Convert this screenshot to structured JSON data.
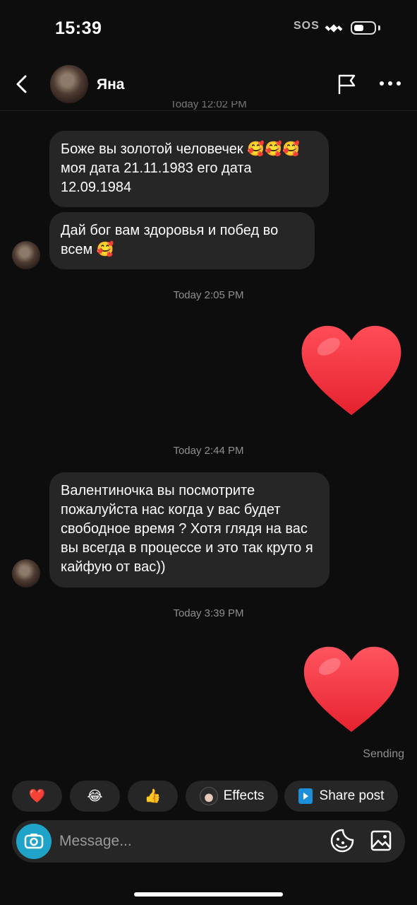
{
  "status_bar": {
    "time": "15:39",
    "sos": "SOS"
  },
  "header": {
    "contact_name": "Яна"
  },
  "partial_timestamp": "Today 12:02 PM",
  "messages": [
    {
      "text": "Боже вы золотой человечек 🥰🥰🥰 моя дата 21.11.1983 его дата 12.09.1984"
    },
    {
      "text": "Дай бог вам здоровья и побед во всем 🥰"
    },
    {
      "text": "Валентиночка вы посмотрите пожалуйста нас когда у вас будет свободное время ? Хотя глядя на вас вы всегда в процессе и это так круто я кайфую от вас))"
    }
  ],
  "timestamps": [
    "Today 2:05 PM",
    "Today 2:44 PM",
    "Today 3:39 PM"
  ],
  "sending_label": "Sending",
  "quick_reactions": {
    "r1": "❤️",
    "r2": "😂",
    "r3": "👍",
    "effects": "Effects",
    "share_post": "Share post"
  },
  "composer": {
    "placeholder": "Message..."
  },
  "colors": {
    "background": "#0d0d0d",
    "bubble": "#262626",
    "camera": "#20a3c9",
    "heart": "#f1313e"
  }
}
